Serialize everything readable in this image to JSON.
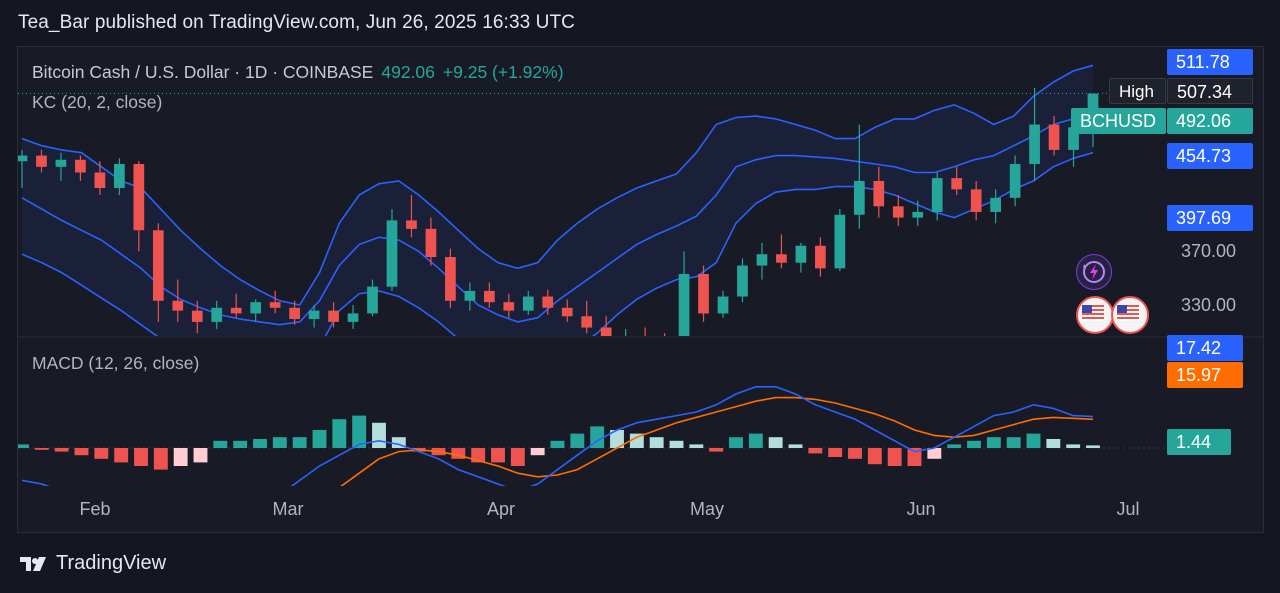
{
  "header": {
    "title": "Tea_Bar published on TradingView.com, Jun 26, 2025 16:33 UTC"
  },
  "footer": {
    "brand": "TradingView"
  },
  "legend": {
    "symbol": "Bitcoin Cash / U.S. Dollar · 1D · COINBASE",
    "last": "492.06",
    "change": "+9.25 (+1.92%)",
    "indicator": "KC (20, 2, close)",
    "macd": "MACD (12, 26, close)"
  },
  "badges": {
    "kc_upper": "511.78",
    "high_label": "High",
    "high_value": "507.34",
    "ticker": "BCHUSD",
    "last_price": "492.06",
    "kc_mid": "454.73",
    "kc_lower": "397.69",
    "macd_line": "17.42",
    "signal_line": "15.97",
    "histogram": "1.44"
  },
  "colors": {
    "up": "#26a69a",
    "down": "#ef5350",
    "band": "#2962ff",
    "signal": "#ff6d00",
    "hist_up": "#26a69a",
    "hist_down": "#ef5350",
    "background": "#181b26"
  },
  "icons": [
    "tradingview-logo-icon",
    "lightning-icon",
    "us-flag-icon"
  ],
  "chart_data": {
    "type": "candlestick",
    "price_axis": {
      "ticks": [
        "370.00",
        "330.00"
      ],
      "ylim": [
        320,
        525
      ]
    },
    "x_axis": {
      "ticks": [
        "Feb",
        "Mar",
        "Apr",
        "May",
        "Jun",
        "Jul"
      ]
    },
    "keltner_channel": {
      "upper": [
        460,
        455,
        452,
        450,
        440,
        430,
        425,
        410,
        395,
        382,
        370,
        360,
        352,
        345,
        342,
        365,
        400,
        420,
        428,
        430,
        420,
        408,
        395,
        382,
        372,
        368,
        372,
        388,
        400,
        410,
        418,
        425,
        430,
        435,
        450,
        470,
        475,
        476,
        474,
        470,
        466,
        460,
        460,
        468,
        474,
        474,
        480,
        484,
        478,
        470,
        476,
        490,
        500,
        508,
        512
      ],
      "middle": [
        418,
        410,
        402,
        395,
        388,
        378,
        368,
        355,
        346,
        340,
        335,
        332,
        330,
        328,
        330,
        345,
        370,
        385,
        390,
        388,
        380,
        368,
        355,
        342,
        335,
        330,
        333,
        345,
        355,
        365,
        375,
        385,
        392,
        398,
        405,
        420,
        440,
        445,
        448,
        448,
        447,
        446,
        444,
        442,
        440,
        436,
        436,
        440,
        445,
        448,
        455,
        462,
        470,
        474,
        478
      ],
      "lower": [
        378,
        372,
        365,
        356,
        347,
        338,
        328,
        318,
        310,
        305,
        302,
        300,
        298,
        297,
        298,
        312,
        338,
        350,
        352,
        348,
        340,
        330,
        318,
        305,
        298,
        294,
        296,
        305,
        312,
        322,
        335,
        346,
        354,
        360,
        362,
        372,
        400,
        414,
        422,
        424,
        424,
        426,
        426,
        424,
        420,
        414,
        408,
        404,
        410,
        416,
        424,
        430,
        440,
        446,
        450
      ],
      "kc_upper_last": 511.78,
      "kc_mid_last": 454.73,
      "kc_lower_last": 397.69
    },
    "candles": [
      {
        "o": 444,
        "h": 452,
        "l": 425,
        "c": 448
      },
      {
        "o": 448,
        "h": 452,
        "l": 436,
        "c": 440
      },
      {
        "o": 440,
        "h": 450,
        "l": 430,
        "c": 445
      },
      {
        "o": 445,
        "h": 448,
        "l": 430,
        "c": 436
      },
      {
        "o": 436,
        "h": 444,
        "l": 420,
        "c": 425
      },
      {
        "o": 425,
        "h": 446,
        "l": 420,
        "c": 442
      },
      {
        "o": 442,
        "h": 444,
        "l": 380,
        "c": 395
      },
      {
        "o": 395,
        "h": 400,
        "l": 330,
        "c": 345
      },
      {
        "o": 345,
        "h": 360,
        "l": 330,
        "c": 338
      },
      {
        "o": 338,
        "h": 345,
        "l": 322,
        "c": 330
      },
      {
        "o": 330,
        "h": 345,
        "l": 325,
        "c": 340
      },
      {
        "o": 340,
        "h": 350,
        "l": 333,
        "c": 336
      },
      {
        "o": 336,
        "h": 346,
        "l": 330,
        "c": 344
      },
      {
        "o": 344,
        "h": 352,
        "l": 336,
        "c": 340
      },
      {
        "o": 340,
        "h": 345,
        "l": 328,
        "c": 332
      },
      {
        "o": 332,
        "h": 342,
        "l": 326,
        "c": 338
      },
      {
        "o": 338,
        "h": 344,
        "l": 326,
        "c": 330
      },
      {
        "o": 330,
        "h": 342,
        "l": 325,
        "c": 336
      },
      {
        "o": 336,
        "h": 360,
        "l": 334,
        "c": 355
      },
      {
        "o": 355,
        "h": 410,
        "l": 352,
        "c": 402
      },
      {
        "o": 402,
        "h": 420,
        "l": 390,
        "c": 396
      },
      {
        "o": 396,
        "h": 404,
        "l": 370,
        "c": 376
      },
      {
        "o": 376,
        "h": 382,
        "l": 340,
        "c": 345
      },
      {
        "o": 345,
        "h": 358,
        "l": 338,
        "c": 352
      },
      {
        "o": 352,
        "h": 358,
        "l": 340,
        "c": 344
      },
      {
        "o": 344,
        "h": 350,
        "l": 333,
        "c": 338
      },
      {
        "o": 338,
        "h": 352,
        "l": 335,
        "c": 348
      },
      {
        "o": 348,
        "h": 353,
        "l": 335,
        "c": 340
      },
      {
        "o": 340,
        "h": 346,
        "l": 330,
        "c": 334
      },
      {
        "o": 334,
        "h": 345,
        "l": 322,
        "c": 326
      },
      {
        "o": 326,
        "h": 334,
        "l": 310,
        "c": 316
      },
      {
        "o": 316,
        "h": 325,
        "l": 305,
        "c": 320
      },
      {
        "o": 320,
        "h": 326,
        "l": 312,
        "c": 315
      },
      {
        "o": 315,
        "h": 322,
        "l": 305,
        "c": 310
      },
      {
        "o": 310,
        "h": 380,
        "l": 306,
        "c": 364
      },
      {
        "o": 364,
        "h": 370,
        "l": 330,
        "c": 336
      },
      {
        "o": 336,
        "h": 352,
        "l": 333,
        "c": 348
      },
      {
        "o": 348,
        "h": 375,
        "l": 344,
        "c": 370
      },
      {
        "o": 370,
        "h": 386,
        "l": 360,
        "c": 378
      },
      {
        "o": 378,
        "h": 392,
        "l": 368,
        "c": 372
      },
      {
        "o": 372,
        "h": 386,
        "l": 365,
        "c": 384
      },
      {
        "o": 384,
        "h": 390,
        "l": 362,
        "c": 368
      },
      {
        "o": 368,
        "h": 410,
        "l": 366,
        "c": 406
      },
      {
        "o": 406,
        "h": 470,
        "l": 396,
        "c": 430
      },
      {
        "o": 430,
        "h": 440,
        "l": 404,
        "c": 412
      },
      {
        "o": 412,
        "h": 420,
        "l": 398,
        "c": 404
      },
      {
        "o": 404,
        "h": 416,
        "l": 398,
        "c": 408
      },
      {
        "o": 408,
        "h": 436,
        "l": 402,
        "c": 432
      },
      {
        "o": 432,
        "h": 440,
        "l": 420,
        "c": 424
      },
      {
        "o": 424,
        "h": 430,
        "l": 402,
        "c": 408
      },
      {
        "o": 408,
        "h": 424,
        "l": 400,
        "c": 418
      },
      {
        "o": 418,
        "h": 448,
        "l": 412,
        "c": 442
      },
      {
        "o": 442,
        "h": 496,
        "l": 430,
        "c": 470
      },
      {
        "o": 470,
        "h": 476,
        "l": 448,
        "c": 452
      },
      {
        "o": 452,
        "h": 474,
        "l": 440,
        "c": 468
      },
      {
        "o": 468,
        "h": 480,
        "l": 454,
        "c": 492
      }
    ],
    "macd": {
      "macd_line": [
        -18,
        -20,
        -24,
        -28,
        -32,
        -36,
        -40,
        -46,
        -48,
        -50,
        -46,
        -40,
        -34,
        -26,
        -18,
        -10,
        -4,
        2,
        4,
        2,
        -2,
        -6,
        -12,
        -16,
        -20,
        -24,
        -20,
        -12,
        -4,
        4,
        10,
        14,
        16,
        18,
        20,
        24,
        30,
        34,
        34,
        30,
        24,
        20,
        16,
        10,
        4,
        -2,
        0,
        6,
        12,
        18,
        20,
        24,
        22,
        18,
        17.42
      ],
      "signal_line": [
        -22,
        -22,
        -23,
        -25,
        -27,
        -30,
        -33,
        -36,
        -40,
        -42,
        -44,
        -43,
        -41,
        -38,
        -33,
        -28,
        -22,
        -14,
        -6,
        -2,
        -1,
        -2,
        -4,
        -7,
        -10,
        -14,
        -16,
        -15,
        -12,
        -6,
        0,
        6,
        10,
        14,
        17,
        20,
        23,
        26,
        28,
        28,
        27,
        25,
        22,
        19,
        15,
        10,
        7,
        6,
        7,
        10,
        13,
        16,
        17,
        16.5,
        15.97
      ],
      "histogram": [
        2,
        -1,
        -2,
        -4,
        -6,
        -8,
        -10,
        -12,
        -10,
        -8,
        4,
        4,
        5,
        6,
        6,
        10,
        16,
        18,
        14,
        6,
        -2,
        -4,
        -6,
        -8,
        -8,
        -10,
        -4,
        4,
        8,
        12,
        10,
        8,
        6,
        4,
        2,
        -2,
        6,
        8,
        6,
        2,
        -3,
        -5,
        -6,
        -9,
        -10,
        -10,
        -6,
        2,
        4,
        6,
        6,
        8,
        5,
        2,
        1.44
      ]
    }
  }
}
